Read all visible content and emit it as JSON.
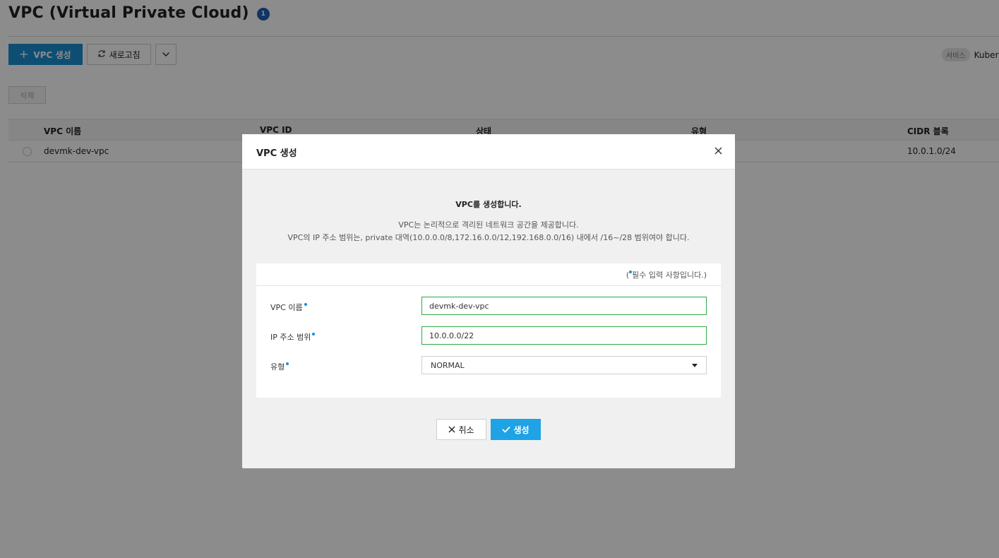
{
  "page": {
    "title": "VPC (Virtual Private Cloud)",
    "count_badge": "1"
  },
  "toolbar": {
    "create_label": "VPC 생성",
    "refresh_label": "새로고침",
    "service_chip": "서비스",
    "service_text": "Kubernetes"
  },
  "actions": {
    "delete_label": "삭제"
  },
  "table": {
    "columns": [
      "VPC 이름",
      "VPC ID",
      "상태",
      "유형",
      "CIDR 블록"
    ],
    "rows": [
      {
        "name": "devmk-dev-vpc",
        "cidr": "10.0.1.0/24"
      }
    ]
  },
  "modal": {
    "title": "VPC 생성",
    "intro_title": "VPC를 생성합니다.",
    "intro_line1": "VPC는 논리적으로 격리된 네트워크 공간을 제공합니다.",
    "intro_line2": "VPC의 IP 주소 범위는, private 대역(10.0.0.0/8,172.16.0.0/12,192.168.0.0/16) 내에서 /16~/28 범위여야 합니다.",
    "required_note_prefix": "(",
    "required_note_text": "필수 입력 사항입니다.)",
    "fields": {
      "vpc_name_label": "VPC 이름",
      "vpc_name_value": "devmk-dev-vpc",
      "ip_range_label": "IP 주소 범위",
      "ip_range_value": "10.0.0.0/22",
      "type_label": "유형",
      "type_value": "NORMAL"
    },
    "cancel_label": "취소",
    "create_label": "생성"
  },
  "colors": {
    "primary": "#1b8fd2",
    "create_button": "#1fa3e4",
    "valid_border": "#2eaa44",
    "badge": "#1e5fb4"
  }
}
